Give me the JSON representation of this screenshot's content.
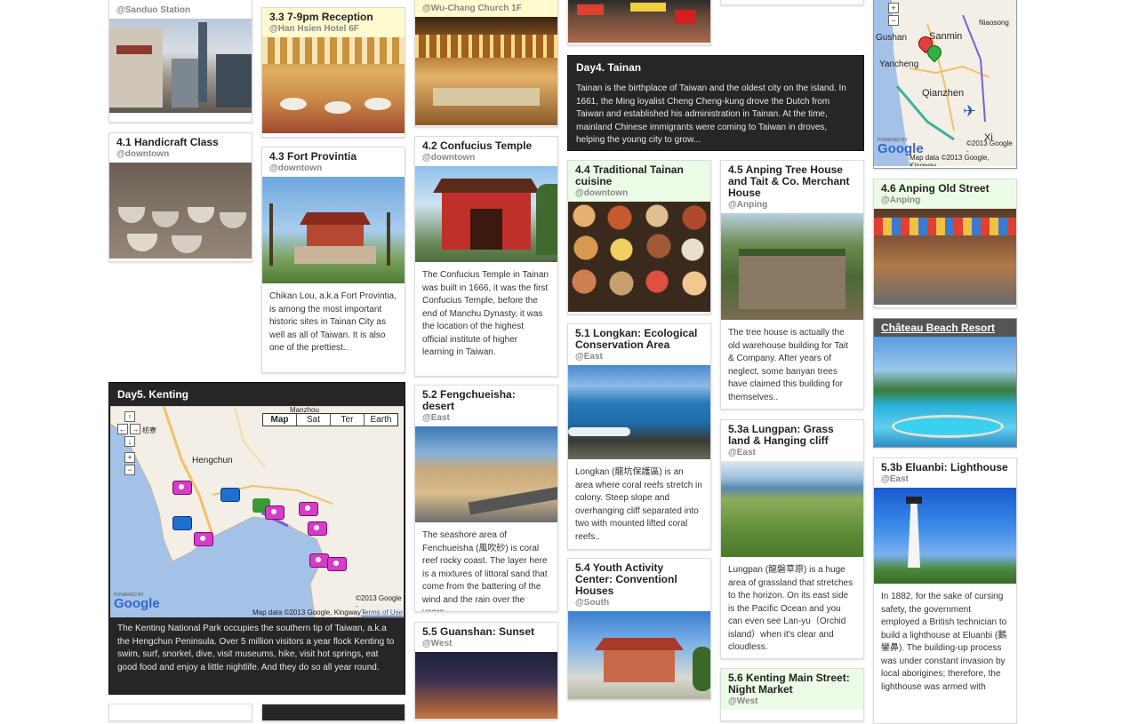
{
  "colors": {
    "dark_panel": "#262626",
    "yellow_head": "#fffbcf",
    "green_head": "#ecfbe6",
    "map_water": "#a4c1e8",
    "map_land": "#f3efe6",
    "pin": "#d63cc7"
  },
  "cards": {
    "sanduo": {
      "loc": "@Sanduo Station"
    },
    "reception": {
      "title": "3.3 7-9pm Reception",
      "loc": "@Han Hsien Hotel 6F"
    },
    "wuchang": {
      "loc": "@Wu-Chang Church 1F"
    },
    "handicraft": {
      "title": "4.1 Handicraft Class",
      "loc": "@downtown"
    },
    "fort": {
      "title": "4.3 Fort Provintia",
      "loc": "@downtown",
      "desc": "Chikan Lou, a.k.a Fort Provintia, is among the most important historic sites in Tainan City as well as all of Taiwan. It is also one of the prettiest.."
    },
    "confucius": {
      "title": "4.2 Confucius Temple",
      "loc": "@downtown",
      "desc": "The Confucius Temple in Tainan was built in 1666, it was the first Confucius Temple, before the end of Manchu Dynasty, it was the location of the highest official institute of higher learning in Taiwan."
    },
    "cuisine": {
      "title": "4.4 Traditional Tainan cuisine",
      "loc": "@downtown"
    },
    "anping_tree": {
      "title": "4.5 Anping Tree House and Tait & Co. Merchant House",
      "loc": "@Anping",
      "desc": "The tree house is actually the old warehouse building for Tait & Company. After years of neglect, some banyan trees have claimed this building for themselves.."
    },
    "anping_street": {
      "title": "4.6 Anping Old Street",
      "loc": "@Anping"
    },
    "longkan": {
      "title": "5.1 Longkan: Ecological Conservation Area",
      "loc": "@East",
      "desc": "Longkan (龍坑保護區) is an area where coral reefs stretch in colony. Steep slope and overhanging cliff separated into two with mounted lifted coral reefs.."
    },
    "fengchueisha": {
      "title": "5.2 Fengchueisha: desert",
      "loc": "@East",
      "desc": "The seashore area of Fenchueisha (風吹砂) is coral reef rocky coast. The layer here is a mixtures of littoral sand that come from the battering of the wind and the rain over the years."
    },
    "lungpan": {
      "title": "5.3a Lungpan: Grass land & Hanging cliff",
      "loc": "@East",
      "desc": "Lungpan (龍磐草原) is a huge area of grassland that stretches to the horizon. On its east side is the Pacific Ocean and you can even see Lan-yu（Orchid island）when it's clear and cloudless."
    },
    "eluanbi": {
      "title": "5.3b Eluanbi: Lighthouse",
      "loc": "@East",
      "desc": "In 1882, for the sake of cursing safety, the government employed a British technician to build a lighthouse at Eluanbi (鵝鑾鼻). The building-up process was under constant invasion by local aborigines; therefore, the lighthouse was armed with"
    },
    "youth": {
      "title": "5.4 Youth Activity Center: Conventionl Houses",
      "loc": "@South"
    },
    "guanshan": {
      "title": "5.5 Guanshan: Sunset",
      "loc": "@West"
    },
    "kenting_street": {
      "title": "5.6 Kenting Main Street: Night Market",
      "loc": "@West"
    }
  },
  "day4": {
    "title": "Day4. Tainan",
    "text": "Tainan is the birthplace of Taiwan and the oldest city on the island. In 1661, the Ming loyalist Cheng Cheng-kung drove the Dutch from Taiwan and established his administration in Tainan. At the time, mainland Chinese immigrants were coming to Taiwan in droves, helping the young city to grow..."
  },
  "day5": {
    "title": "Day5. Kenting",
    "text": "The Kenting National Park occupies the southern tip of Taiwan, a.k.a the Hengchun Peninsula. Over 5 million visitors a year flock Kenting to swim, surf, snorkel, dive, visit museums, hike, visit hot springs, eat good food and enjoy a little nightlife. And they do so all year round.",
    "map": {
      "types": [
        "Map",
        "Sat",
        "Ter",
        "Earth"
      ],
      "active": "Map",
      "labels": {
        "hengchun": "Hengchun",
        "manzhou": "Manzhou",
        "fangliao": "枋寮"
      },
      "copyright": "©2013 Google -",
      "mapdata": "Map data ©2013 Google, Kingway -",
      "terms": "Terms of Use",
      "powered": "POWERED BY",
      "google": "Google"
    }
  },
  "resort": {
    "title": "Château Beach Resort"
  },
  "kaohsiung_map": {
    "labels": {
      "gushan": "Gushan",
      "sanmin": "Sanmin",
      "niaosong": "Niaosong",
      "yancheng": "Yancheng",
      "qianzhen": "Qianzhen",
      "xiaogang": "Xi"
    },
    "copyright": "©2013 Google -",
    "mapdata": "Map data ©2013 Google, Kingway",
    "powered": "POWERED BY",
    "google": "Google"
  }
}
